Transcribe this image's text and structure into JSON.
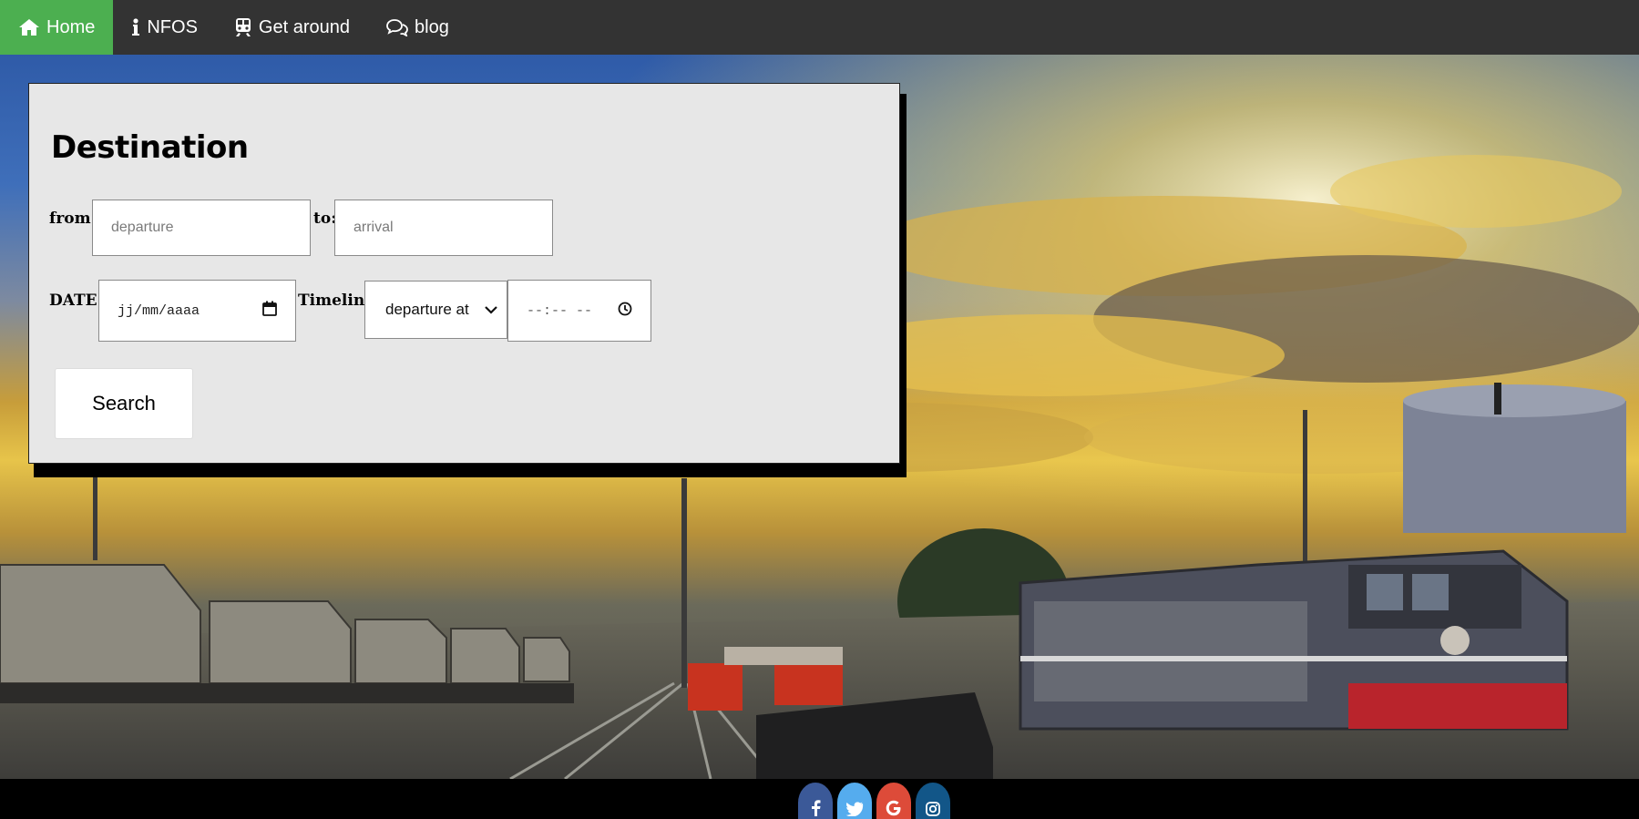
{
  "nav": {
    "items": [
      {
        "label": "Home",
        "icon": "home-icon",
        "active": true
      },
      {
        "label": "NFOS",
        "icon": "info-icon",
        "active": false
      },
      {
        "label": "Get around",
        "icon": "train-icon",
        "active": false
      },
      {
        "label": "blog",
        "icon": "chat-icon",
        "active": false
      }
    ],
    "colors": {
      "bar": "#333333",
      "active": "#4CAF50",
      "text": "#ffffff"
    }
  },
  "form": {
    "title": "Destination",
    "from_label": "from:",
    "from_placeholder": "departure",
    "to_label": "to:",
    "to_placeholder": "arrival",
    "date_label": "DATE:",
    "date_value": "jj/mm/aaaa",
    "timeline_label": "Timeline",
    "timeline_selected": "departure at",
    "time_value": "--:-- --",
    "search_label": "Search",
    "icons": {
      "date": "calendar-icon",
      "time": "clock-icon",
      "select": "chevron-down-icon"
    }
  },
  "footer": {
    "social": [
      {
        "name": "facebook",
        "icon": "facebook-icon",
        "color": "#3B5998"
      },
      {
        "name": "twitter",
        "icon": "twitter-icon",
        "color": "#55ACEE"
      },
      {
        "name": "google",
        "icon": "google-icon",
        "color": "#DD4B39"
      },
      {
        "name": "instagram",
        "icon": "instagram-icon",
        "color": "#125688"
      }
    ]
  }
}
